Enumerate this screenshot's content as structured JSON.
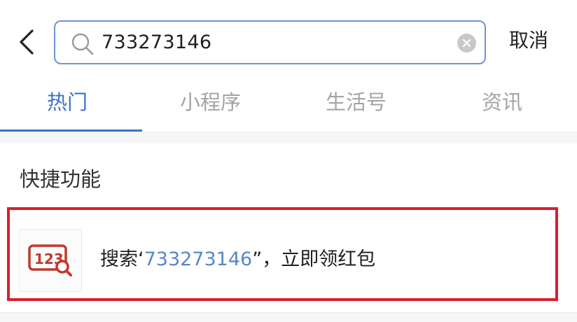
{
  "search": {
    "query": "733273146",
    "cancel_label": "取消"
  },
  "tabs": [
    {
      "label": "热门",
      "active": true
    },
    {
      "label": "小程序",
      "active": false
    },
    {
      "label": "生活号",
      "active": false
    },
    {
      "label": "资讯",
      "active": false
    }
  ],
  "section": {
    "title": "快捷功能"
  },
  "feature": {
    "prefix": "搜索‘",
    "keyword": "733273146",
    "suffix": "”，立即领红包",
    "icon_text": "123"
  },
  "colors": {
    "accent": "#3d73c4",
    "highlight": "#d9202d",
    "icon": "#c0392b"
  }
}
